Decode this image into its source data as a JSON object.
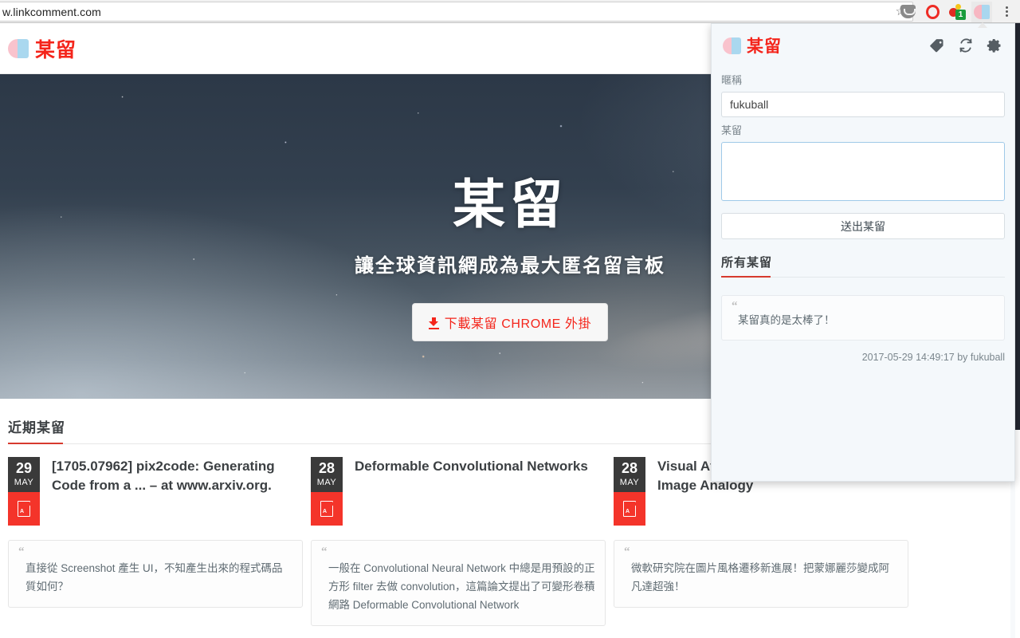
{
  "browser": {
    "url": "w.linkcomment.com",
    "bookmark_icon": "star-icon",
    "toolbar_icons": [
      "pocket-icon",
      "opera-icon",
      "people-icon",
      "linkcomment-extension-icon",
      "chrome-menu-icon"
    ],
    "people_badge_count": "1"
  },
  "site": {
    "brand": "某留",
    "hero": {
      "title": "某留",
      "subtitle": "讓全球資訊網成為最大匿名留言板",
      "cta_label": "下載某留 CHROME 外掛"
    },
    "recent": {
      "section_title": "近期某留",
      "cards": [
        {
          "day": "29",
          "month": "MAY",
          "title": "[1705.07962] pix2code: Generating Code from a ... – at www.arxiv.org.",
          "comment": "直接從 Screenshot 產生 UI，不知產生出來的程式碼品質如何？"
        },
        {
          "day": "28",
          "month": "MAY",
          "title": "Deformable Convolutional Networks",
          "comment": "一般在 Convolutional Neural Network 中總是用預設的正方形 filter 去做 convolution，這篇論文提出了可變形卷積網路 Deformable Convolutional Network"
        },
        {
          "day": "28",
          "month": "MAY",
          "title": "Visual Attribute Transfer through Deep Image Analogy",
          "comment": "微軟研究院在圖片風格遷移新進展！把蒙娜麗莎變成阿凡達超強！"
        }
      ]
    }
  },
  "popup": {
    "brand": "某留",
    "actions": [
      "tag-icon",
      "refresh-icon",
      "gear-icon"
    ],
    "nickname_label": "暱稱",
    "nickname_value": "fukuball",
    "comment_label": "某留",
    "comment_value": "",
    "submit_label": "送出某留",
    "all_comments_title": "所有某留",
    "comments": [
      {
        "text": "某留真的是太棒了！",
        "meta": "2017-05-29 14:49:17 by fukuball"
      }
    ]
  },
  "colors": {
    "brand_red": "#f4251b",
    "accent_rule": "#d73a2e",
    "badge_dark": "#3a3a3a",
    "badge_red": "#f4342a",
    "popup_bg": "#f4f8fb",
    "focus_blue": "#9fc9e8"
  }
}
